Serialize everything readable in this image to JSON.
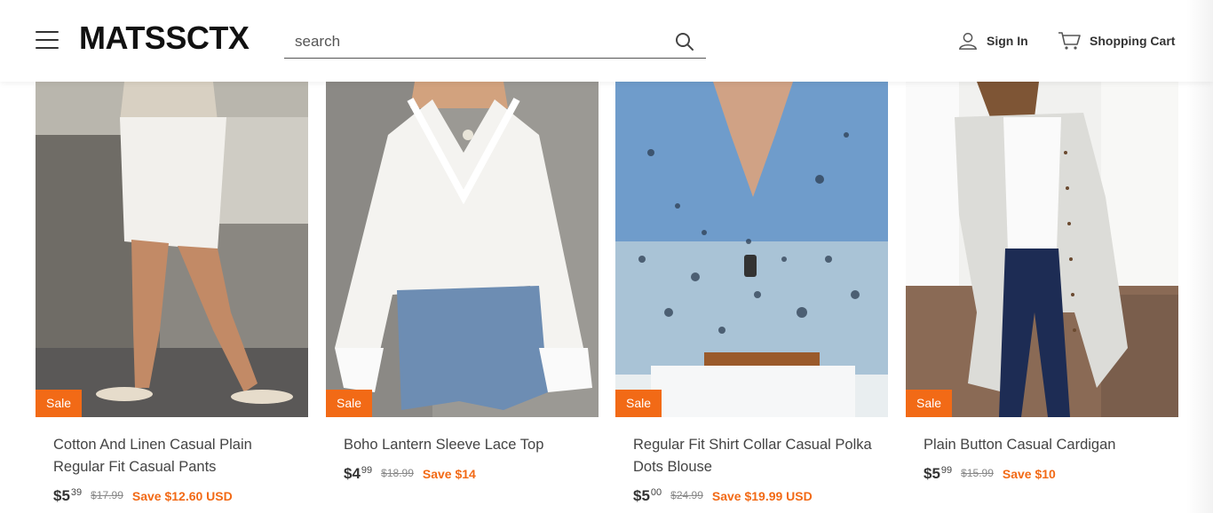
{
  "header": {
    "logo": "MATSSCTX",
    "search": {
      "placeholder": "search",
      "value": ""
    },
    "signin_label": "Sign In",
    "cart_label": "Shopping Cart"
  },
  "products": [
    {
      "title": "Cotton And Linen Casual Plain Regular Fit Casual Pants",
      "badge": "Sale",
      "price_whole": "$5",
      "price_cents": "39",
      "price_old": "$17.99",
      "save": "Save $12.60 USD"
    },
    {
      "title": "Boho Lantern Sleeve Lace Top",
      "badge": "Sale",
      "price_whole": "$4",
      "price_cents": "99",
      "price_old": "$18.99",
      "save": "Save $14"
    },
    {
      "title": "Regular Fit Shirt Collar Casual Polka Dots Blouse",
      "badge": "Sale",
      "price_whole": "$5",
      "price_cents": "00",
      "price_old": "$24.99",
      "save": "Save $19.99 USD"
    },
    {
      "title": "Plain Button Casual Cardigan",
      "badge": "Sale",
      "price_whole": "$5",
      "price_cents": "99",
      "price_old": "$15.99",
      "save": "Save $10"
    }
  ],
  "colors": {
    "accent": "#f26a16",
    "text": "#333333"
  }
}
